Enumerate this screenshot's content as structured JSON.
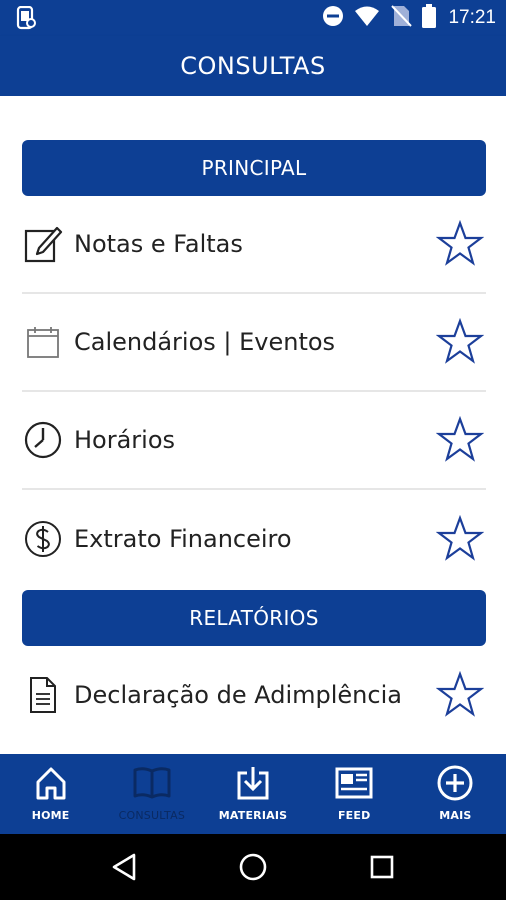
{
  "status_bar": {
    "time": "17:21",
    "icons": [
      "app-notification-icon",
      "do-not-disturb-icon",
      "wifi-icon",
      "no-sim-icon",
      "battery-icon"
    ]
  },
  "app_bar": {
    "title": "CONSULTAS"
  },
  "sections": [
    {
      "title": "PRINCIPAL",
      "items": [
        {
          "label": "Notas e Faltas",
          "icon": "edit-note-icon",
          "favorite": false
        },
        {
          "label": "Calendários | Eventos",
          "icon": "calendar-icon",
          "favorite": false
        },
        {
          "label": "Horários",
          "icon": "clock-icon",
          "favorite": false
        },
        {
          "label": "Extrato Financeiro",
          "icon": "dollar-icon",
          "favorite": false
        }
      ]
    },
    {
      "title": "RELATÓRIOS",
      "items": [
        {
          "label": "Declaração de Adimplência",
          "icon": "document-icon",
          "favorite": false
        }
      ]
    }
  ],
  "bottom_nav": {
    "items": [
      {
        "label": "HOME",
        "icon": "home-icon",
        "active": false
      },
      {
        "label": "CONSULTAS",
        "icon": "book-icon",
        "active": true
      },
      {
        "label": "MATERIAIS",
        "icon": "download-icon",
        "active": false
      },
      {
        "label": "FEED",
        "icon": "news-icon",
        "active": false
      },
      {
        "label": "MAIS",
        "icon": "plus-circle-icon",
        "active": false
      }
    ]
  },
  "colors": {
    "primary": "#0d3f94",
    "star_outline": "#1c3f9a",
    "active_nav": "#0a2a63",
    "divider": "#e6e6e6"
  }
}
